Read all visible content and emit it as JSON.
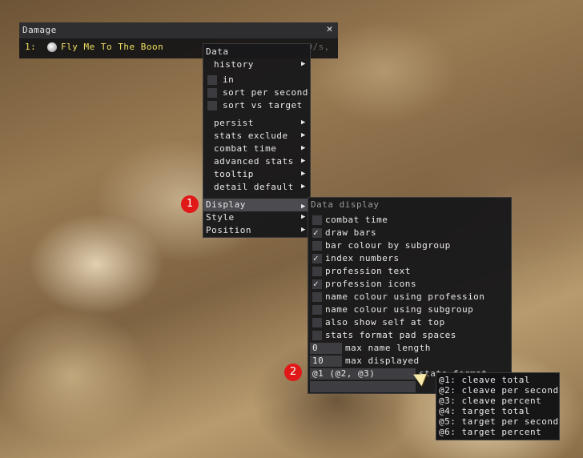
{
  "damage_window": {
    "title": "Damage",
    "close_glyph": "✕",
    "row": {
      "index": "1:",
      "name": "Fly Me To The Boon",
      "value": "0 (0/s, 0%)",
      "icon": "profession-icon"
    }
  },
  "data_menu": {
    "header": "Data",
    "history": "history",
    "in": "in",
    "sort_per_second": "sort per second",
    "sort_vs_target": "sort vs target",
    "persist": "persist",
    "stats_exclude": "stats exclude",
    "combat_time": "combat time",
    "advanced_stats": "advanced stats",
    "tooltip": "tooltip",
    "detail_default": "detail default",
    "display": "Display",
    "style": "Style",
    "position": "Position",
    "arrow_glyph": "▶"
  },
  "display_menu": {
    "header": "Data display",
    "options": [
      {
        "label": "combat time",
        "checked": false
      },
      {
        "label": "draw bars",
        "checked": true
      },
      {
        "label": "bar colour by subgroup",
        "checked": false
      },
      {
        "label": "index numbers",
        "checked": true
      },
      {
        "label": "profession text",
        "checked": false
      },
      {
        "label": "profession icons",
        "checked": true
      },
      {
        "label": "name colour using profession",
        "checked": false
      },
      {
        "label": "name colour using subgroup",
        "checked": false
      },
      {
        "label": "also show self at top",
        "checked": false
      },
      {
        "label": "stats format pad spaces",
        "checked": false
      }
    ],
    "max_name_length": {
      "value": "0",
      "label": "max name length"
    },
    "max_displayed": {
      "value": "10",
      "label": "max displayed"
    },
    "stats_format": {
      "value": "@1 (@2, @3)",
      "label": "stats format"
    },
    "check_glyph": "✓"
  },
  "format_dropdown": {
    "items": [
      "@1: cleave total",
      "@2: cleave per second",
      "@3: cleave percent",
      "@4: target total",
      "@5: target per second",
      "@6: target percent"
    ]
  },
  "badges": {
    "one": "1",
    "two": "2"
  },
  "colors": {
    "badge": "#e01818",
    "name": "#f0e060",
    "highlight": "#4b4b50"
  }
}
